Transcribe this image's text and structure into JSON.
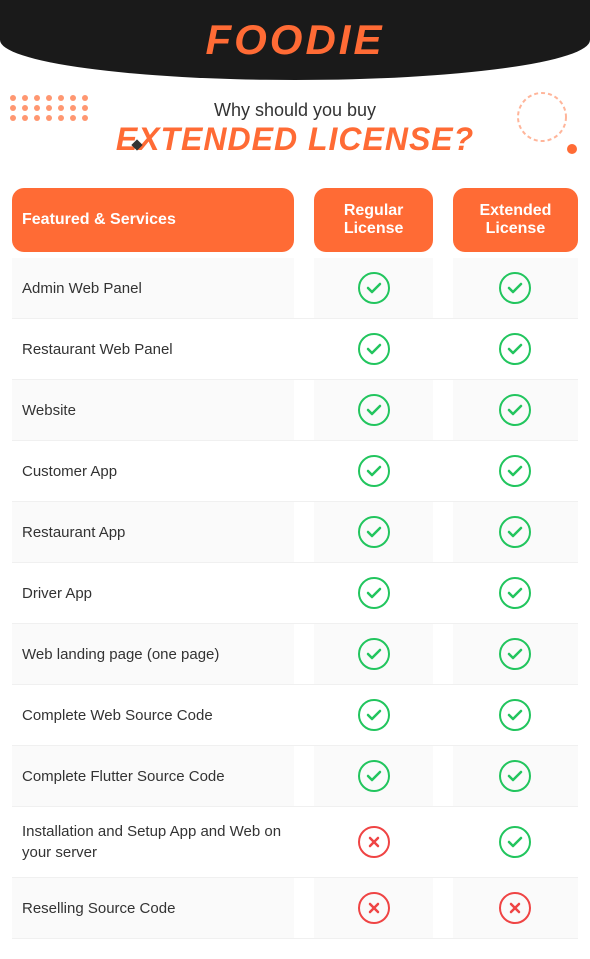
{
  "header": {
    "title": "FOODIE",
    "why_text": "Why should you buy",
    "license_text": "EXTENDED LICENSE?"
  },
  "table": {
    "columns": {
      "features": "Featured & Services",
      "regular": "Regular License",
      "extended": "Extended License"
    },
    "rows": [
      {
        "feature": "Admin Web Panel",
        "regular": "check",
        "extended": "check"
      },
      {
        "feature": "Restaurant Web Panel",
        "regular": "check",
        "extended": "check"
      },
      {
        "feature": "Website",
        "regular": "check",
        "extended": "check"
      },
      {
        "feature": "Customer App",
        "regular": "check",
        "extended": "check"
      },
      {
        "feature": "Restaurant App",
        "regular": "check",
        "extended": "check"
      },
      {
        "feature": "Driver App",
        "regular": "check",
        "extended": "check"
      },
      {
        "feature": "Web landing page (one page)",
        "regular": "check",
        "extended": "check"
      },
      {
        "feature": "Complete Web Source Code",
        "regular": "check",
        "extended": "check"
      },
      {
        "feature": "Complete Flutter Source Code",
        "regular": "check",
        "extended": "check"
      },
      {
        "feature": "Installation and Setup App and Web on your server",
        "regular": "cross",
        "extended": "check"
      },
      {
        "feature": "Reselling Source Code",
        "regular": "cross",
        "extended": "cross"
      }
    ]
  },
  "icons": {
    "check_symbol": "✓",
    "cross_symbol": "✕"
  }
}
